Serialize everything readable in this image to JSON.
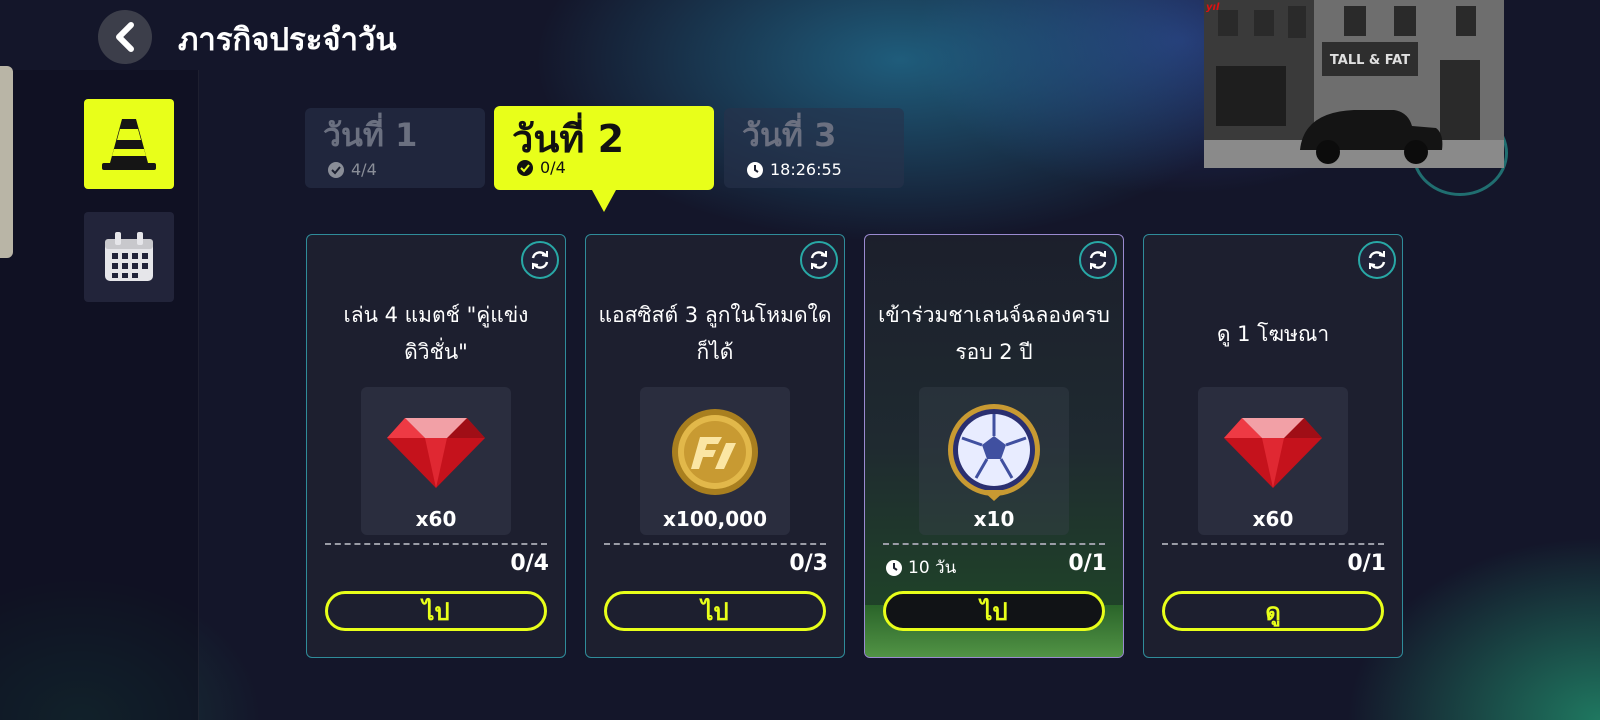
{
  "header": {
    "title": "ภารกิจประจำวัน",
    "back_icon": "chevron-left-icon"
  },
  "sidebar": {
    "items": [
      {
        "name": "missions",
        "icon": "traffic-cone-icon",
        "active": true
      },
      {
        "name": "calendar",
        "icon": "calendar-icon",
        "active": false
      }
    ]
  },
  "days": [
    {
      "label": "วันที่ 1",
      "status": "4/4",
      "status_icon": "check-circle-icon",
      "active": false
    },
    {
      "label": "วันที่ 2",
      "status": "0/4",
      "status_icon": "check-circle-icon",
      "active": true
    },
    {
      "label": "วันที่ 3",
      "status": "18:26:55",
      "status_icon": "clock-icon",
      "active": false
    }
  ],
  "missions": [
    {
      "title": "เล่น 4 แมตช์ \"คู่แข่งดิวิชั่น\"",
      "reward_icon": "red-gem-icon",
      "reward_qty": "x60",
      "progress": "0/4",
      "button": "ไป"
    },
    {
      "title": "แอสซิสต์ 3 ลูกในโหมดใดก็ได้",
      "reward_icon": "gold-coin-icon",
      "reward_qty": "x100,000",
      "progress": "0/3",
      "button": "ไป"
    },
    {
      "title": "เข้าร่วมชาเลนจ์ฉลองครบรอบ 2 ปี",
      "reward_icon": "football-badge-icon",
      "reward_qty": "x10",
      "progress": "0/1",
      "timer": "10 วัน",
      "button": "ไป",
      "featured": true
    },
    {
      "title": "ดู 1 โฆษณา",
      "reward_icon": "red-gem-icon",
      "reward_qty": "x60",
      "progress": "0/1",
      "button": "ดู"
    }
  ],
  "overlay": {
    "sign_text": "TALL & FAT",
    "corner_text": "yıl"
  },
  "colors": {
    "accent": "#e8ff1a",
    "teal": "#28a8a6",
    "background": "#14162a"
  }
}
